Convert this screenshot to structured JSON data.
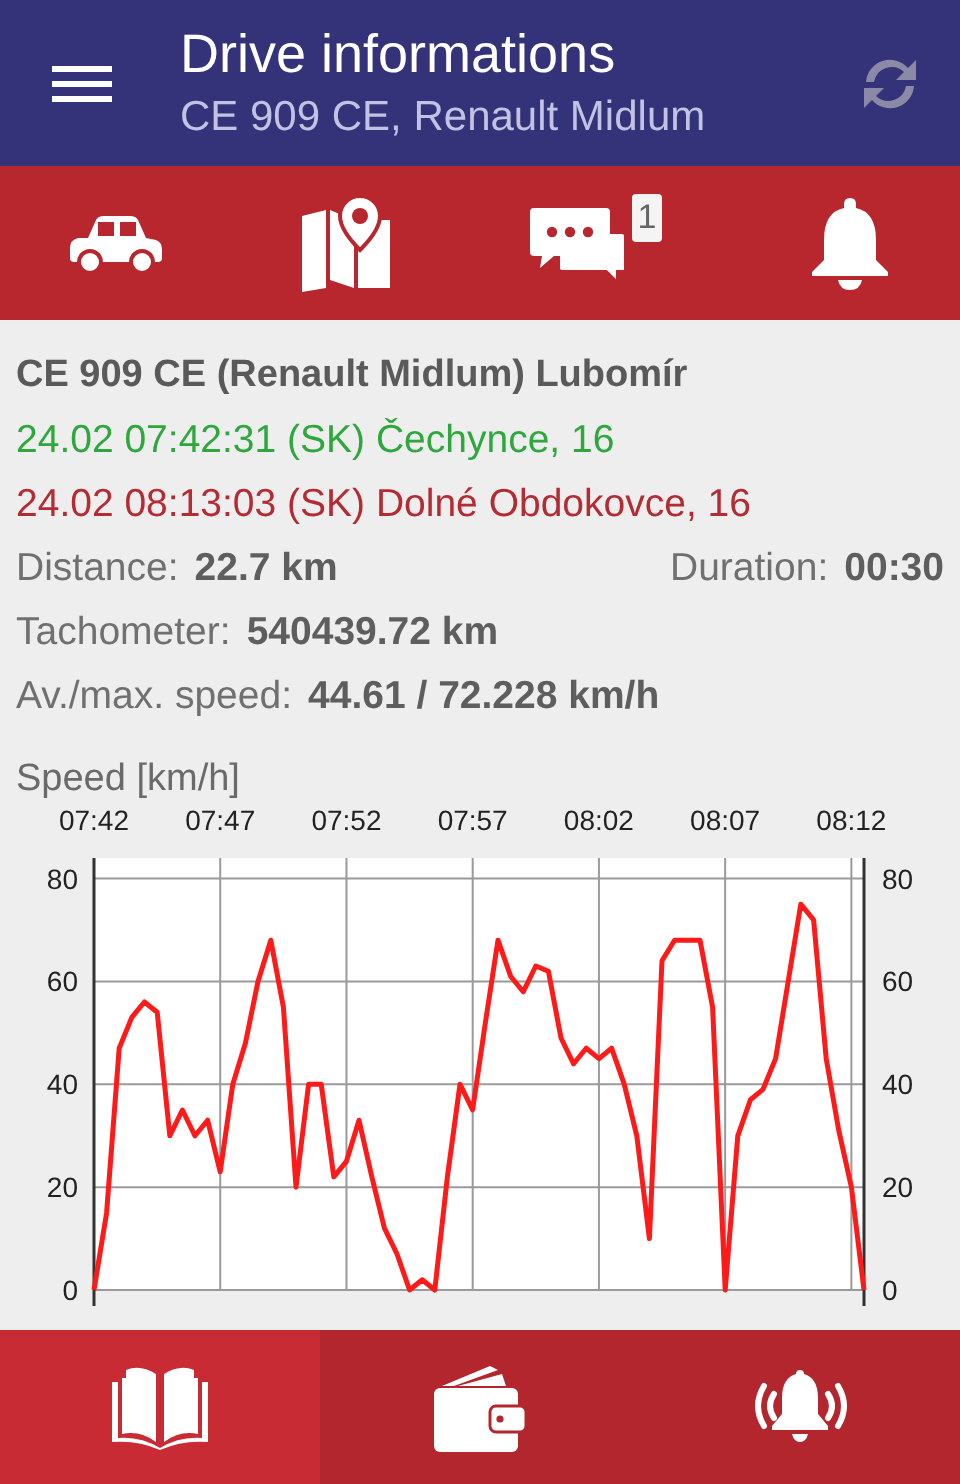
{
  "app_bar": {
    "title": "Drive informations",
    "subtitle": "CE 909 CE, Renault Midlum"
  },
  "top_tabs": [
    {
      "kind": "car"
    },
    {
      "kind": "map"
    },
    {
      "kind": "messages",
      "badge": "1"
    },
    {
      "kind": "bell"
    }
  ],
  "drive": {
    "heading": "CE 909 CE (Renault Midlum) Lubomír",
    "start": "24.02 07:42:31 (SK) Čechynce, 16",
    "end": "24.02 08:13:03 (SK) Dolné Obdokovce, 16",
    "distance": {
      "label": "Distance:",
      "value": "22.7 km"
    },
    "duration": {
      "label": "Duration:",
      "value": "00:30"
    },
    "tachometer": {
      "label": "Tachometer:",
      "value": "540439.72 km"
    },
    "speed": {
      "label": "Av./max. speed:",
      "value": "44.61 / 72.228 km/h"
    }
  },
  "chart": {
    "chart_data": {
      "type": "line",
      "ylabel": "Speed [km/h]",
      "ylim": [
        0,
        84
      ],
      "y2lim": [
        0,
        84
      ],
      "categories": [
        "07:42",
        null,
        null,
        null,
        null,
        null,
        null,
        null,
        null,
        null,
        "07:47",
        null,
        null,
        null,
        null,
        null,
        null,
        null,
        null,
        null,
        "07:52",
        null,
        null,
        null,
        null,
        null,
        null,
        null,
        null,
        null,
        "07:57",
        null,
        null,
        null,
        null,
        null,
        null,
        null,
        null,
        null,
        "08:02",
        null,
        null,
        null,
        null,
        null,
        null,
        null,
        null,
        null,
        "08:07",
        null,
        null,
        null,
        null,
        null,
        null,
        null,
        null,
        null,
        "08:12",
        null
      ],
      "grid": true,
      "yticks": [
        0,
        20,
        40,
        60,
        80
      ],
      "y2ticks": [
        0,
        20,
        40,
        60,
        80
      ],
      "series": [
        {
          "color": "#ff1a1a",
          "values": [
            0,
            15,
            47,
            53,
            56,
            54,
            30,
            35,
            30,
            33,
            23,
            40,
            48,
            60,
            68,
            55,
            20,
            40,
            40,
            22,
            25,
            33,
            22,
            12,
            7,
            0,
            2,
            0,
            22,
            40,
            35,
            52,
            68,
            61,
            58,
            63,
            62,
            49,
            44,
            47,
            45,
            47,
            40,
            30,
            10,
            64,
            68,
            68,
            68,
            55,
            0,
            30,
            37,
            39,
            45,
            60,
            75,
            72,
            45,
            31,
            20,
            0
          ]
        }
      ]
    }
  },
  "bottom_nav": [
    {
      "kind": "book",
      "selected": true
    },
    {
      "kind": "wallet",
      "selected": false
    },
    {
      "kind": "alarm",
      "selected": false
    }
  ]
}
